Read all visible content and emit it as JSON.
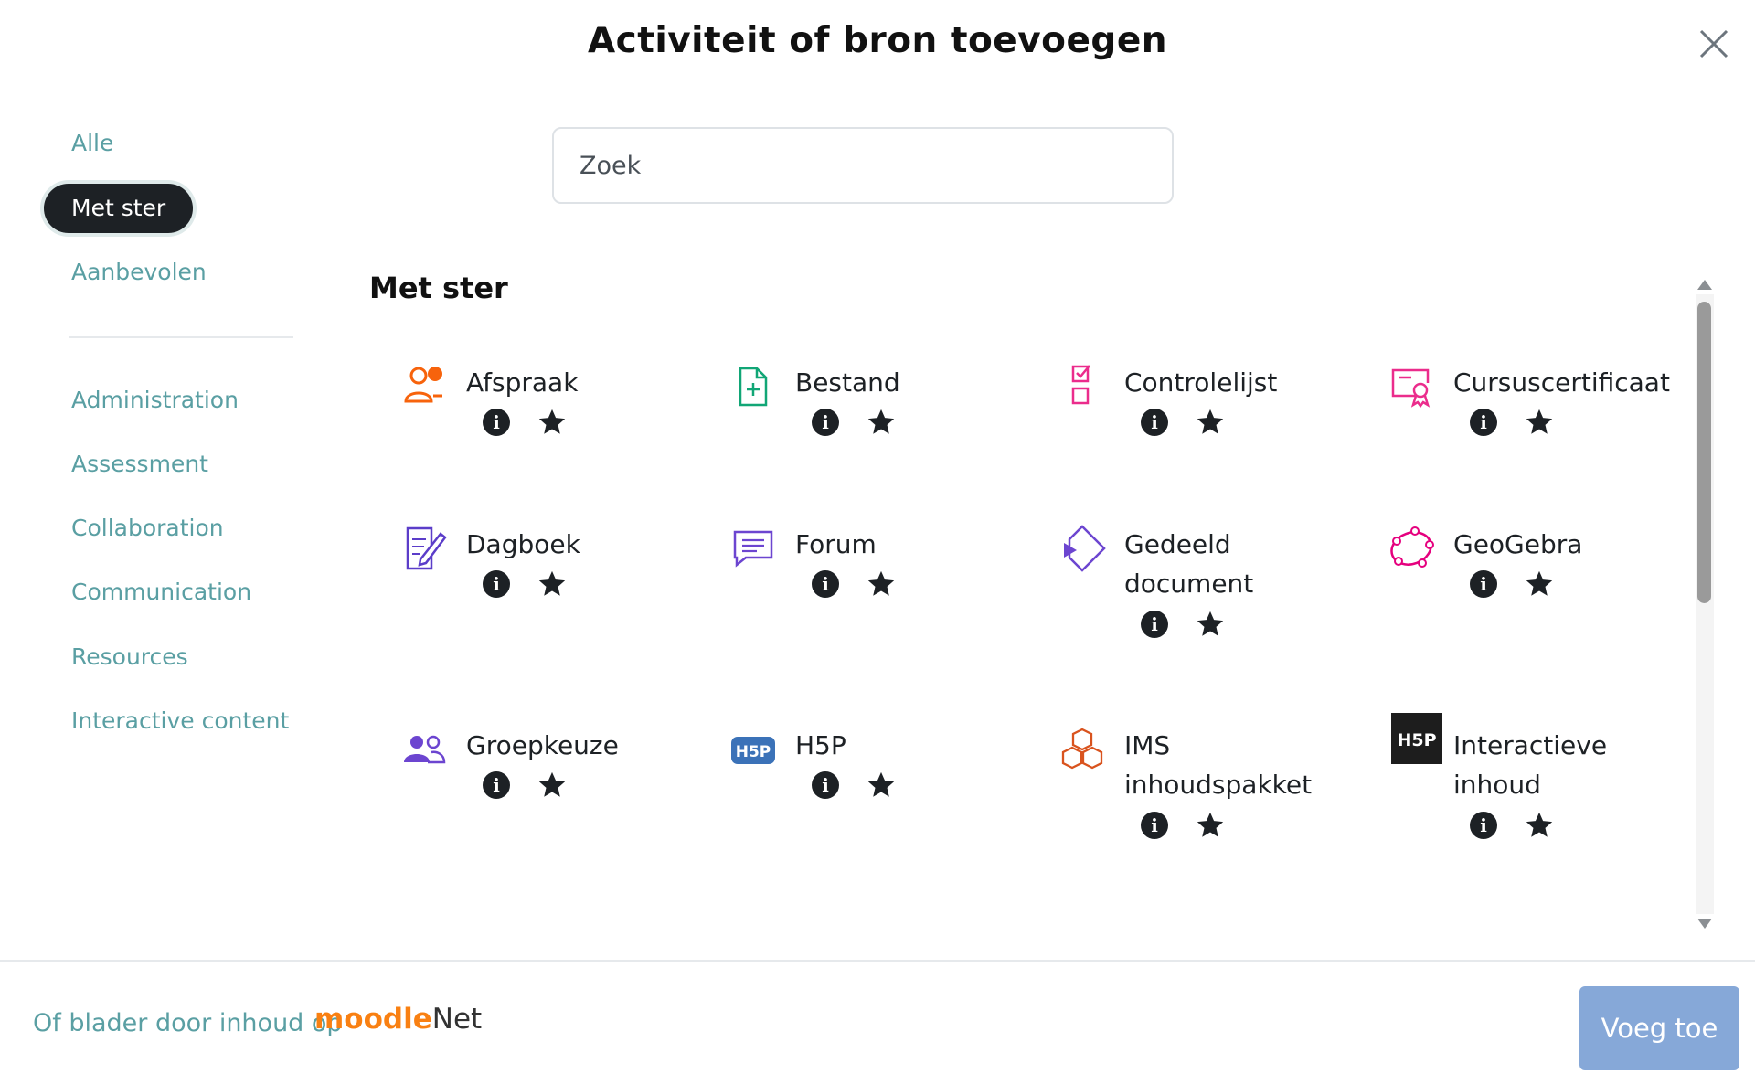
{
  "modal": {
    "title": "Activiteit of bron toevoegen"
  },
  "nav": {
    "items": [
      {
        "label": "Alle"
      },
      {
        "label": "Met ster"
      },
      {
        "label": "Aanbevolen"
      },
      {
        "label": "Administration"
      },
      {
        "label": "Assessment"
      },
      {
        "label": "Collaboration"
      },
      {
        "label": "Communication"
      },
      {
        "label": "Resources"
      },
      {
        "label": "Interactive content"
      }
    ],
    "active": "Met ster"
  },
  "search": {
    "placeholder": "Zoek",
    "value": ""
  },
  "section": {
    "title": "Met ster"
  },
  "items": [
    {
      "name": "Afspraak",
      "icon": "appointment-icon",
      "color": "#f7630c"
    },
    {
      "name": "Bestand",
      "icon": "file-icon",
      "color": "#11a676"
    },
    {
      "name": "Controlelijst",
      "icon": "checklist-icon",
      "color": "#eb2c8c"
    },
    {
      "name": "Cursuscertificaat",
      "icon": "certificate-icon",
      "color": "#eb2c8c"
    },
    {
      "name": "Dagboek",
      "icon": "journal-icon",
      "color": "#5b3dc9"
    },
    {
      "name": "Forum",
      "icon": "forum-icon",
      "color": "#6c45d0"
    },
    {
      "name": "Gedeeld document",
      "icon": "shared-document-icon",
      "color": "#6c45d0"
    },
    {
      "name": "GeoGebra",
      "icon": "geogebra-icon",
      "color": "#e5007e"
    },
    {
      "name": "Groepkeuze",
      "icon": "group-choice-icon",
      "color": "#6c45d0"
    },
    {
      "name": "H5P",
      "icon": "h5p-icon",
      "color": "#3b72b8"
    },
    {
      "name": "IMS inhoudspakket",
      "icon": "ims-package-icon",
      "color": "#d9531e"
    },
    {
      "name": "Interactieve inhoud",
      "icon": "h5p-black-icon",
      "color": "#1d1d1d"
    }
  ],
  "footer": {
    "text": "Of blader door inhoud op",
    "moodlenet_a": "moodle",
    "moodlenet_b": "Net",
    "add_button": "Voeg toe"
  }
}
